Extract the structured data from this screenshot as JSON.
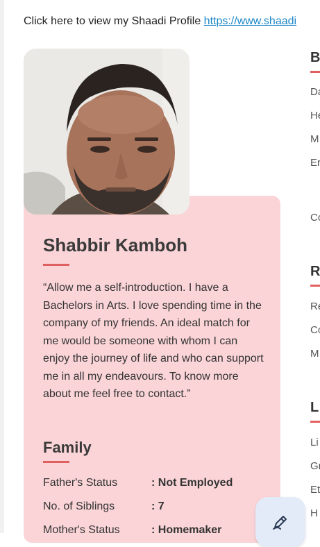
{
  "top_link": {
    "text": "Click here to view my Shaadi Profile",
    "url_text": "https://www.shaadi"
  },
  "profile": {
    "name": "Shabbir Kamboh",
    "intro": "“Allow me a self-introduction. I have a Bachelors in Arts. I love spending time in the company of my friends. An ideal match for me would be someone with whom I can enjoy the journey of life and who can support me in all my endeavours. To know more about me feel free to contact.”"
  },
  "family": {
    "title": "Family",
    "rows": [
      {
        "label": "Father's Status",
        "value": ": Not Employed"
      },
      {
        "label": "No. of Siblings",
        "value": ": 7"
      },
      {
        "label": "Mother's Status",
        "value": ": Homemaker"
      }
    ]
  },
  "right_column": {
    "sections": [
      {
        "title": "B",
        "items": [
          "Da",
          "He",
          "M",
          "Er",
          "Co"
        ]
      },
      {
        "title": "R",
        "items": [
          "Re",
          "Co",
          "M"
        ]
      },
      {
        "title": "L",
        "items": [
          "Li",
          "Gr",
          "Et",
          "H"
        ]
      }
    ]
  },
  "fab": {
    "icon": "edit-pen-icon"
  },
  "colors": {
    "card_bg": "#fad4d7",
    "accent_rule": "#e0605f",
    "link": "#1e88c7",
    "fab_bg": "#e3ebf8"
  }
}
